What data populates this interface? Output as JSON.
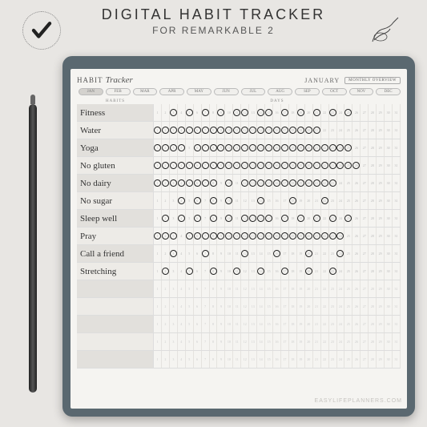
{
  "header": {
    "title": "DIGITAL HABIT TRACKER",
    "subtitle": "FOR REMARKABLE 2"
  },
  "sheet": {
    "titlePrefix": "HABIT",
    "titleScript": "Tracker",
    "month": "JANUARY",
    "overviewBtn": "MONTHLY OVERVIEW",
    "habitsLabel": "HABITS",
    "daysLabel": "DAYS"
  },
  "months": [
    "JAN",
    "FEB",
    "MAR",
    "APR",
    "MAY",
    "JUN",
    "JUL",
    "AUG",
    "SEP",
    "OCT",
    "NOV",
    "DEC"
  ],
  "activeMonth": 0,
  "days": 31,
  "habits": [
    {
      "name": "Fitness",
      "marks": [
        3,
        5,
        7,
        9,
        11,
        12,
        14,
        15,
        17,
        19,
        21,
        23,
        25
      ]
    },
    {
      "name": "Water",
      "marks": [
        1,
        2,
        3,
        4,
        5,
        6,
        7,
        8,
        9,
        10,
        11,
        12,
        13,
        14,
        15,
        16,
        17,
        18,
        19,
        20,
        21
      ]
    },
    {
      "name": "Yoga",
      "marks": [
        1,
        2,
        3,
        4,
        6,
        7,
        8,
        9,
        10,
        11,
        12,
        13,
        14,
        15,
        16,
        17,
        18,
        19,
        20,
        21,
        22,
        23,
        24,
        25
      ]
    },
    {
      "name": "No gluten",
      "marks": [
        1,
        2,
        3,
        4,
        5,
        6,
        7,
        8,
        9,
        10,
        11,
        12,
        13,
        14,
        15,
        16,
        17,
        18,
        19,
        20,
        21,
        22,
        23,
        24,
        25,
        26
      ]
    },
    {
      "name": "No dairy",
      "marks": [
        1,
        2,
        3,
        4,
        5,
        6,
        7,
        8,
        10,
        12,
        13,
        14,
        15,
        16,
        17,
        18,
        19,
        20,
        21,
        22,
        23
      ]
    },
    {
      "name": "No sugar",
      "marks": [
        4,
        6,
        8,
        10,
        14,
        18,
        22
      ]
    },
    {
      "name": "Sleep well",
      "marks": [
        2,
        4,
        6,
        8,
        10,
        12,
        13,
        14,
        15,
        17,
        19,
        21,
        23,
        25
      ]
    },
    {
      "name": "Pray",
      "marks": [
        1,
        2,
        3,
        5,
        6,
        7,
        8,
        9,
        10,
        11,
        12,
        13,
        14,
        15,
        16,
        17,
        18,
        19,
        20,
        21,
        22,
        23,
        24
      ]
    },
    {
      "name": "Call a friend",
      "marks": [
        3,
        7,
        12,
        16,
        20,
        24
      ]
    },
    {
      "name": "Stretching",
      "marks": [
        2,
        5,
        8,
        11,
        14,
        17,
        20,
        23
      ]
    }
  ],
  "emptyRows": 5,
  "watermark": "EASYLIFEPLANNERS.COM"
}
